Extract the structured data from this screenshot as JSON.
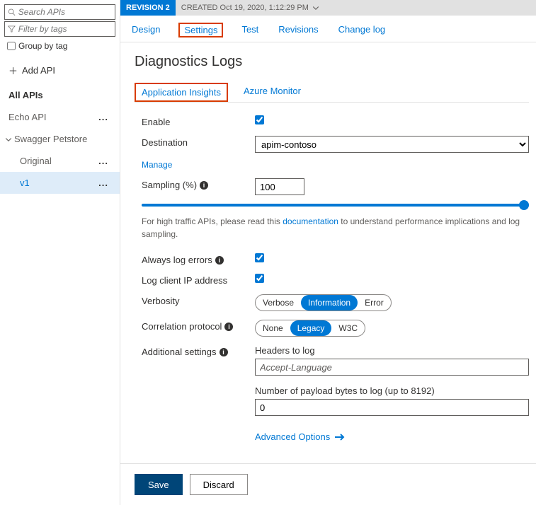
{
  "sidebar": {
    "search_placeholder": "Search APIs",
    "filter_placeholder": "Filter by tags",
    "group_by_label": "Group by tag",
    "add_api_label": "Add API",
    "all_apis_label": "All APIs",
    "items": [
      {
        "label": "Echo API"
      }
    ],
    "group_label": "Swagger Petstore",
    "group_items": [
      {
        "label": "Original"
      },
      {
        "label": "v1",
        "selected": true
      }
    ]
  },
  "revision": {
    "badge": "REVISION 2",
    "created": "CREATED Oct 19, 2020, 1:12:29 PM"
  },
  "tabs": {
    "design": "Design",
    "settings": "Settings",
    "test": "Test",
    "revisions": "Revisions",
    "changelog": "Change log"
  },
  "page_title": "Diagnostics Logs",
  "subtabs": {
    "ai": "Application Insights",
    "am": "Azure Monitor"
  },
  "form": {
    "enable_label": "Enable",
    "destination_label": "Destination",
    "destination_value": "apim-contoso",
    "manage_label": "Manage",
    "sampling_label": "Sampling (%)",
    "sampling_value": "100",
    "note_prefix": "For high traffic APIs, please read this ",
    "note_link": "documentation",
    "note_suffix": " to understand performance implications and log sampling.",
    "always_log_label": "Always log errors",
    "log_ip_label": "Log client IP address",
    "verbosity_label": "Verbosity",
    "verbosity_options": {
      "verbose": "Verbose",
      "information": "Information",
      "error": "Error"
    },
    "correlation_label": "Correlation protocol",
    "correlation_options": {
      "none": "None",
      "legacy": "Legacy",
      "w3c": "W3C"
    },
    "additional_label": "Additional settings",
    "headers_label": "Headers to log",
    "headers_value": "Accept-Language",
    "payload_label": "Number of payload bytes to log (up to 8192)",
    "payload_value": "0",
    "advanced_label": "Advanced Options"
  },
  "footer": {
    "save": "Save",
    "discard": "Discard"
  }
}
